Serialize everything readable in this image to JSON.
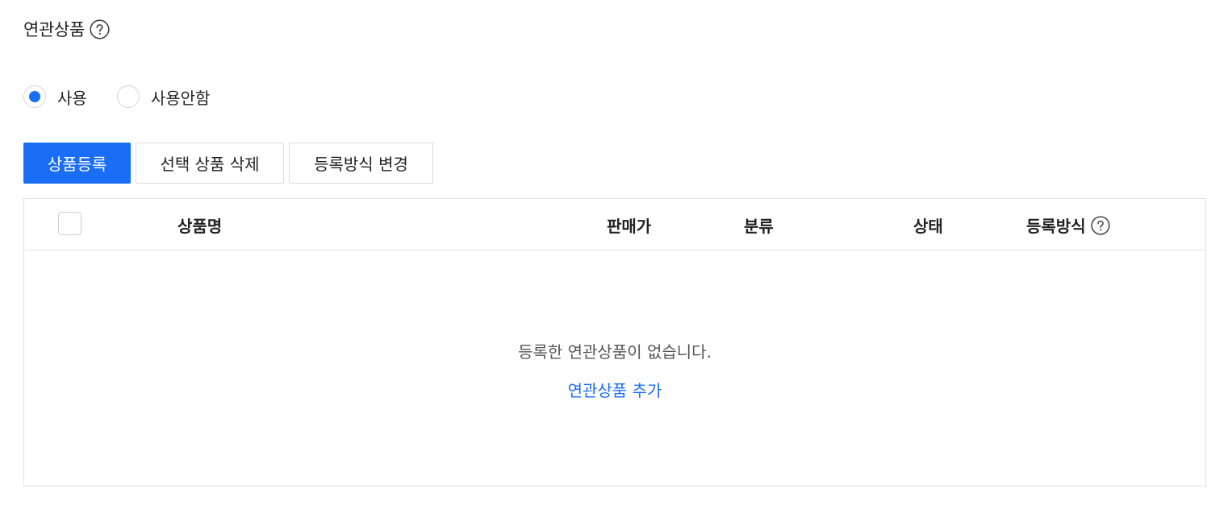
{
  "section": {
    "title": "연관상품",
    "help_icon": "question-circle-icon"
  },
  "usage": {
    "options": [
      {
        "label": "사용",
        "checked": true
      },
      {
        "label": "사용안함",
        "checked": false
      }
    ]
  },
  "toolbar": {
    "register_label": "상품등록",
    "delete_label": "선택 상품 삭제",
    "change_method_label": "등록방식 변경"
  },
  "table": {
    "columns": {
      "name": "상품명",
      "price": "판매가",
      "category": "분류",
      "status": "상태",
      "method": "등록방식"
    },
    "empty_message": "등록한 연관상품이 없습니다.",
    "add_link": "연관상품 추가"
  },
  "colors": {
    "accent": "#1a6ef5",
    "text": "#222222",
    "border": "#e1e1e1"
  }
}
